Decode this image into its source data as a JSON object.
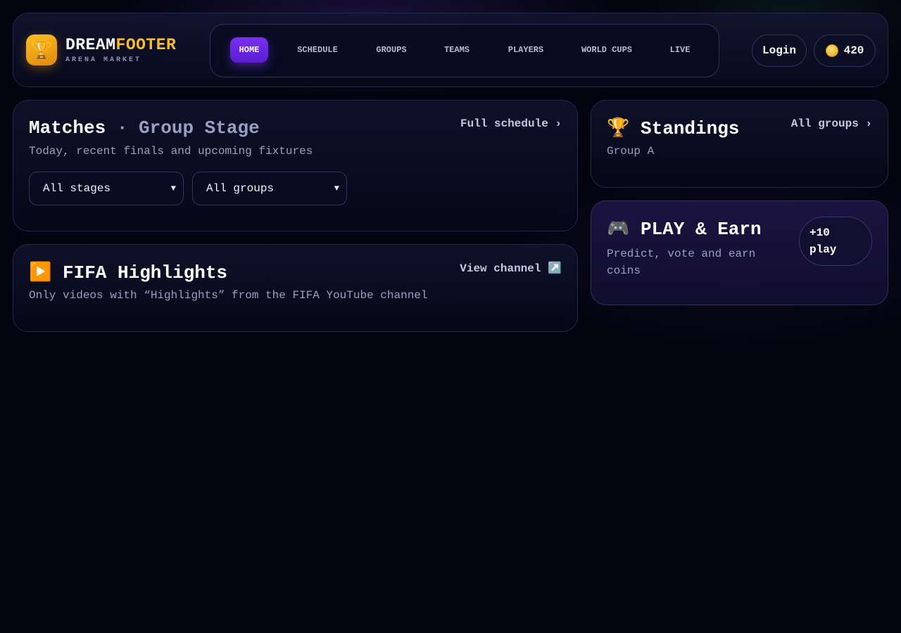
{
  "brand": {
    "logo_icon": "trophy-icon",
    "name_part1": "DREAM",
    "name_part2": "FOOTER",
    "subtitle": "ARENA MARKET"
  },
  "nav": {
    "items": [
      {
        "label": "HOME",
        "active": true
      },
      {
        "label": "SCHEDULE",
        "active": false
      },
      {
        "label": "GROUPS",
        "active": false
      },
      {
        "label": "TEAMS",
        "active": false
      },
      {
        "label": "PLAYERS",
        "active": false
      },
      {
        "label": "WORLD CUPS",
        "active": false
      },
      {
        "label": "LIVE",
        "active": false
      }
    ]
  },
  "header_actions": {
    "login_label": "Login",
    "coins_value": "420",
    "coin_icon": "coin-icon"
  },
  "matches": {
    "title": "Matches",
    "separator": "·",
    "title_muted": "Group Stage",
    "subtitle": "Today, recent finals and upcoming fixtures",
    "link": "Full schedule ›",
    "stage_select": "All stages",
    "group_select": "All groups"
  },
  "highlights": {
    "icon": "play-button-icon",
    "title": "FIFA Highlights",
    "subtitle": "Only videos with “Highlights” from the FIFA YouTube channel",
    "link": "View channel",
    "link_icon": "external-link-icon"
  },
  "standings": {
    "icon": "trophy-icon",
    "title": "Standings",
    "subtitle": "Group A",
    "link": "All groups ›"
  },
  "play_earn": {
    "icon": "gamepad-icon",
    "title": "PLAY & Earn",
    "subtitle_line1": "Predict, vote and earn",
    "subtitle_line2": "coins",
    "pill_line1": "+10",
    "pill_line2": "play"
  },
  "colors": {
    "background": "#03040f",
    "accent_purple": "#6a24e0",
    "brand_gold": "#fbbf24"
  }
}
